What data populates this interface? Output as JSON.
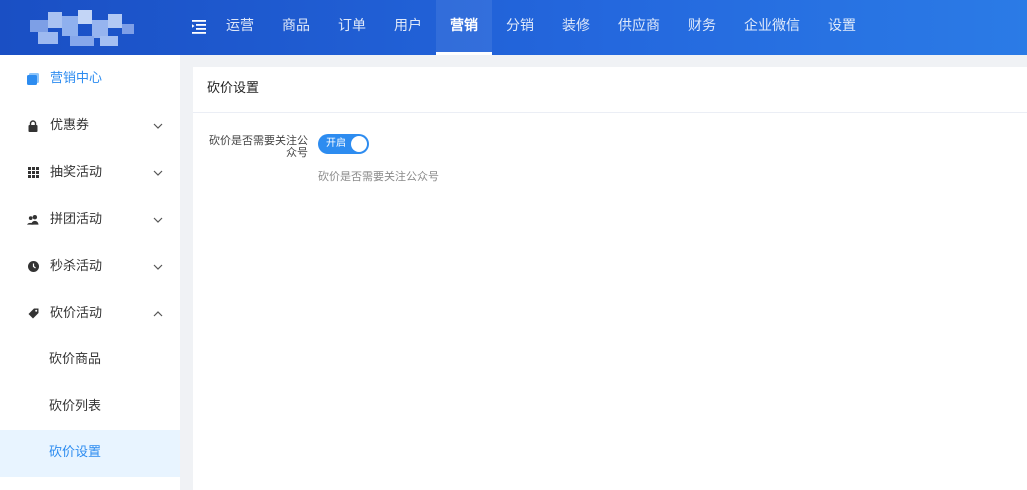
{
  "topnav": {
    "items": [
      {
        "label": "运营"
      },
      {
        "label": "商品"
      },
      {
        "label": "订单"
      },
      {
        "label": "用户"
      },
      {
        "label": "营销",
        "active": true
      },
      {
        "label": "分销"
      },
      {
        "label": "装修"
      },
      {
        "label": "供应商"
      },
      {
        "label": "财务"
      },
      {
        "label": "企业微信"
      },
      {
        "label": "设置"
      }
    ]
  },
  "sidebar": {
    "center": {
      "label": "营销中心",
      "icon": "square-icon"
    },
    "groups": [
      {
        "label": "优惠券",
        "icon": "lock-icon",
        "expanded": false
      },
      {
        "label": "抽奖活动",
        "icon": "grid-icon",
        "expanded": false
      },
      {
        "label": "拼团活动",
        "icon": "users-icon",
        "expanded": false
      },
      {
        "label": "秒杀活动",
        "icon": "clock-icon",
        "expanded": false
      },
      {
        "label": "砍价活动",
        "icon": "tag-icon",
        "expanded": true
      }
    ],
    "subitems": [
      {
        "label": "砍价商品"
      },
      {
        "label": "砍价列表"
      },
      {
        "label": "砍价设置",
        "active": true
      }
    ]
  },
  "content": {
    "title": "砍价设置",
    "field": {
      "label": "砍价是否需要关注公众号",
      "switch_text": "开启",
      "switch_on": true,
      "help": "砍价是否需要关注公众号"
    }
  },
  "colors": {
    "topbar": "#2468de",
    "accent": "#2d8cf0",
    "active_bg": "#e8f4ff"
  }
}
